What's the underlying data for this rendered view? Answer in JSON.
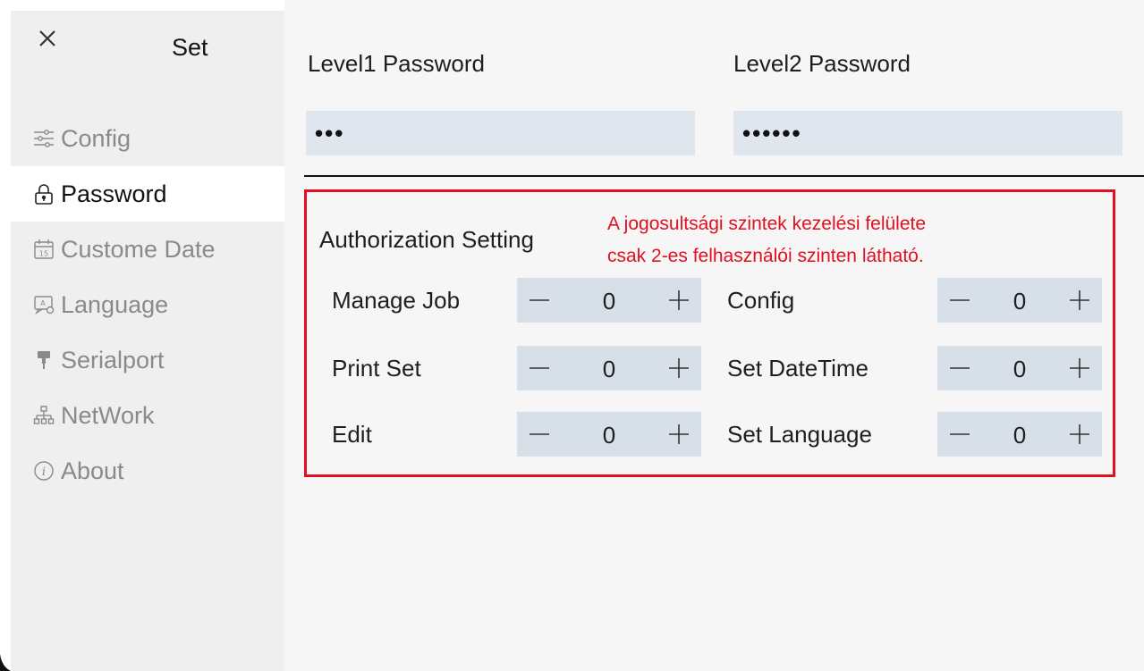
{
  "window": {
    "title": "Set"
  },
  "sidebar": {
    "items": [
      {
        "label": "Config",
        "icon": "sliders-icon"
      },
      {
        "label": "Password",
        "icon": "lock-icon",
        "active": true
      },
      {
        "label": "Custome Date",
        "icon": "calendar-icon"
      },
      {
        "label": "Language",
        "icon": "language-icon"
      },
      {
        "label": "Serialport",
        "icon": "serialport-icon"
      },
      {
        "label": "NetWork",
        "icon": "network-icon"
      },
      {
        "label": "About",
        "icon": "info-icon"
      }
    ]
  },
  "passwords": {
    "level1": {
      "label": "Level1 Password",
      "value": "•••"
    },
    "level2": {
      "label": "Level2 Password",
      "value": "••••••"
    }
  },
  "authorization": {
    "title": "Authorization Setting",
    "note_line1": "A jogosultsági szintek kezelési felülete",
    "note_line2": "csak 2-es felhasználói szinten látható.",
    "left": [
      {
        "label": "Manage Job",
        "value": "0"
      },
      {
        "label": "Print Set",
        "value": "0"
      },
      {
        "label": "Edit",
        "value": "0"
      }
    ],
    "right": [
      {
        "label": "Config",
        "value": "0"
      },
      {
        "label": "Set DateTime",
        "value": "0"
      },
      {
        "label": "Set Language",
        "value": "0"
      }
    ]
  },
  "colors": {
    "sidebar_bg": "#efefef",
    "main_bg": "#f6f6f6",
    "input_bg": "#dfe6ee",
    "stepper_bg": "#d7e0e8",
    "highlight_red": "#e01020"
  }
}
